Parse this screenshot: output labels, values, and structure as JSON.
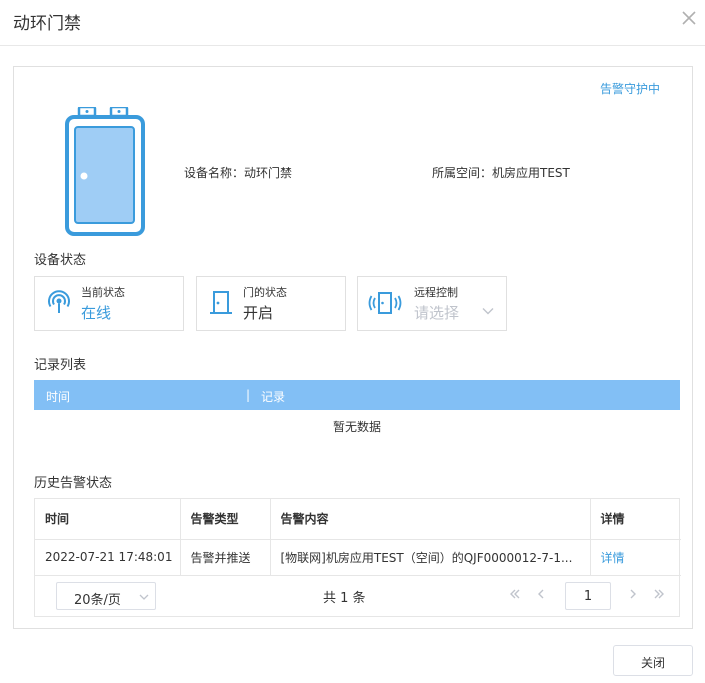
{
  "dialog": {
    "title": "动环门禁",
    "close_button_label": "关闭"
  },
  "device": {
    "guard_status": "告警守护中",
    "name_label": "设备名称：",
    "name": "动环门禁",
    "space_label": "所属空间：",
    "space": "机房应用TEST"
  },
  "device_status": {
    "title": "设备状态",
    "current": {
      "label": "当前状态",
      "value": "在线",
      "icon": "signal-icon"
    },
    "door": {
      "label": "门的状态",
      "value": "开启",
      "icon": "door-icon"
    },
    "remote": {
      "label": "远程控制",
      "placeholder": "请选择",
      "icon": "remote-door-icon"
    }
  },
  "records": {
    "title": "记录列表",
    "columns": [
      "时间",
      "记录"
    ],
    "separator": "|",
    "empty_text": "暂无数据"
  },
  "history": {
    "title": "历史告警状态",
    "columns": [
      "时间",
      "告警类型",
      "告警内容",
      "详情"
    ],
    "rows": [
      {
        "time": "2022-07-21 17:48:01",
        "type": "告警并推送",
        "content": "[物联网]机房应用TEST（空间）的QJF0000012-7-1...",
        "detail": "详情"
      }
    ],
    "pager": {
      "page_size": "20条/页",
      "total": "共 1 条",
      "current_page": "1"
    }
  },
  "colors": {
    "accent": "#3a9bdc",
    "table_header": "#82bff5",
    "door_fill": "#9fcdf5",
    "door_stroke": "#3a9bdc"
  }
}
